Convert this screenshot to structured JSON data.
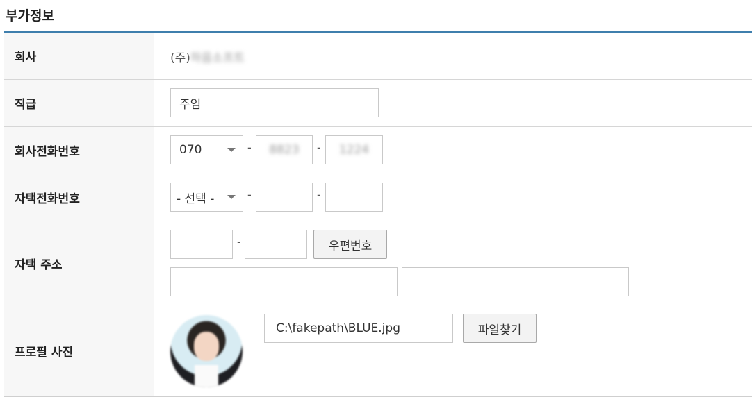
{
  "section_title": "부가정보",
  "company": {
    "label": "회사",
    "value_prefix": "(주)",
    "value_blurred": "하음소프트"
  },
  "rank": {
    "label": "직급",
    "value": "주임"
  },
  "company_phone": {
    "label": "회사전화번호",
    "area_selected": "070",
    "mid": "8823",
    "last": "1224",
    "sep": "-"
  },
  "home_phone": {
    "label": "자택전화번호",
    "area_selected": "- 선택 -",
    "mid": "",
    "last": "",
    "sep": "-"
  },
  "home_address": {
    "label": "자택 주소",
    "zip1": "",
    "zip2": "",
    "zip_button": "우편번호",
    "addr1": "",
    "addr2": "",
    "sep": "-"
  },
  "profile_photo": {
    "label": "프로필 사진",
    "file_path": "C:\\fakepath\\BLUE.jpg",
    "find_button": "파일찾기"
  },
  "colors": {
    "accent": "#3f7fad",
    "label_bg": "#f7f7f7",
    "border": "#d6d6d6"
  },
  "icons": {
    "select_caret": "chevron-down-icon"
  }
}
